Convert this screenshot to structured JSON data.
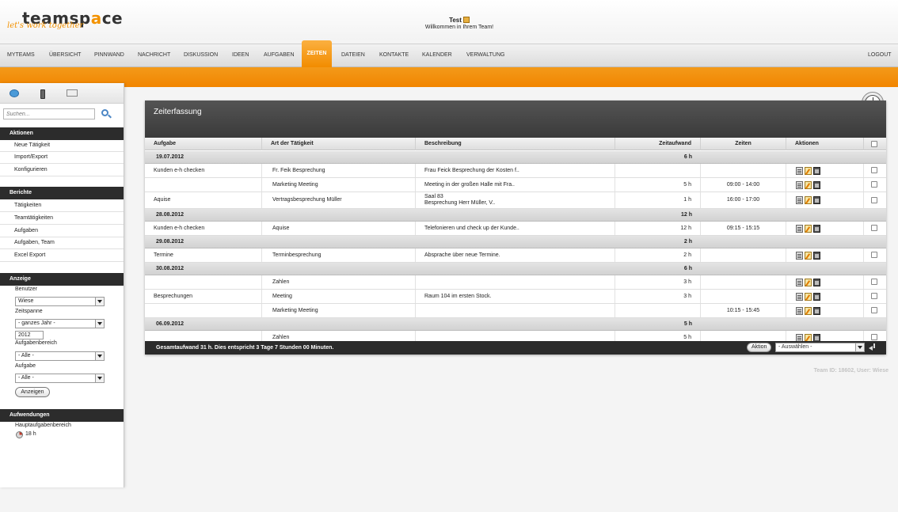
{
  "brand": {
    "name": "teamspace",
    "tagline": "let's work together"
  },
  "user": {
    "name": "Test",
    "welcome": "Willkommen in Ihrem Team!"
  },
  "nav": {
    "items": [
      "MYTEAMS",
      "ÜBERSICHT",
      "PINNWAND",
      "NACHRICHT",
      "DISKUSSION",
      "IDEEN",
      "AUFGABEN",
      "ZEITEN",
      "DATEIEN",
      "KONTAKTE",
      "KALENDER",
      "VERWALTUNG"
    ],
    "active": "ZEITEN",
    "logout": "LOGOUT"
  },
  "sidebar": {
    "search_placeholder": "Suchen...",
    "aktionen": {
      "title": "Aktionen",
      "items": [
        "Neue Tätigkeit",
        "Import/Export",
        "Konfigurieren"
      ]
    },
    "berichte": {
      "title": "Berichte",
      "items": [
        "Tätigkeiten",
        "Teamtätigkeiten",
        "Aufgaben",
        "Aufgaben, Team",
        "Excel Export"
      ]
    },
    "anzeige": {
      "title": "Anzeige",
      "benutzer_label": "Benutzer",
      "benutzer_value": "Wiese",
      "zeitspanne_label": "Zeitspanne",
      "zeitspanne_value": "- ganzes Jahr -",
      "year_value": "2012",
      "aufgabenbereich_label": "Aufgabenbereich",
      "aufgabenbereich_value": "- Alle -",
      "aufgabe_label": "Aufgabe",
      "aufgabe_value": "- Alle -",
      "button": "Anzeigen"
    },
    "aufwendungen": {
      "title": "Aufwendungen",
      "label": "Hauptaufgabenbereich",
      "value": "18 h"
    }
  },
  "panel": {
    "title": "Zeiterfassung",
    "columns": [
      "Aufgabe",
      "Art der Tätigkeit",
      "Beschreibung",
      "Zeitaufwand",
      "Zeiten",
      "Aktionen"
    ],
    "rows": [
      {
        "type": "group",
        "date": "19.07.2012",
        "total": "6 h"
      },
      {
        "type": "entry",
        "aufgabe": "Kunden e-h checken",
        "art": "Fr. Feik Besprechung",
        "beschreibung": "Frau Feick Besprechung der Kosten f..",
        "zeitaufwand": "",
        "zeiten": ""
      },
      {
        "type": "entry",
        "aufgabe": "",
        "art": "Marketing Meeting",
        "beschreibung": "Meeting in der großen Halle mit Fra..",
        "zeitaufwand": "5 h",
        "zeiten": "09:00 - 14:00"
      },
      {
        "type": "entry",
        "aufgabe": "Aquise",
        "art": "Vertragsbesprechung Müller",
        "beschreibung": "Saal 83\nBesprechung Herr Müller, V..",
        "zeitaufwand": "1 h",
        "zeiten": "16:00 - 17:00"
      },
      {
        "type": "group",
        "date": "28.08.2012",
        "total": "12 h"
      },
      {
        "type": "entry",
        "aufgabe": "Kunden e-h checken",
        "art": "Aquise",
        "beschreibung": "Telefonieren und check up der Kunde..",
        "zeitaufwand": "12 h",
        "zeiten": "09:15 - 15:15"
      },
      {
        "type": "group",
        "date": "29.08.2012",
        "total": "2 h"
      },
      {
        "type": "entry",
        "aufgabe": "Termine",
        "art": "Terminbesprechung",
        "beschreibung": "Absprache über neue Termine.",
        "zeitaufwand": "2 h",
        "zeiten": ""
      },
      {
        "type": "group",
        "date": "30.08.2012",
        "total": "6 h"
      },
      {
        "type": "entry",
        "aufgabe": "",
        "art": "Zahlen",
        "beschreibung": "",
        "zeitaufwand": "3 h",
        "zeiten": ""
      },
      {
        "type": "entry",
        "aufgabe": "Besprechungen",
        "art": "Meeting",
        "beschreibung": "Raum 104 im ersten Stock.",
        "zeitaufwand": "3 h",
        "zeiten": ""
      },
      {
        "type": "entry",
        "aufgabe": "",
        "art": "Marketing Meeting",
        "beschreibung": "",
        "zeitaufwand": "",
        "zeiten": "10:15 - 15:45"
      },
      {
        "type": "group",
        "date": "06.09.2012",
        "total": "5 h"
      },
      {
        "type": "entry",
        "aufgabe": "",
        "art": "Zahlen",
        "beschreibung": "",
        "zeitaufwand": "5 h",
        "zeiten": ""
      }
    ],
    "footer_text": "Gesamtaufwand 31 h. Dies entspricht  3 Tage 7 Stunden 00 Minuten.",
    "aktion_button": "Aktion",
    "aktion_select": "- Auswählen -"
  },
  "team_id_text": "Team ID: 18602, User: Wiese"
}
